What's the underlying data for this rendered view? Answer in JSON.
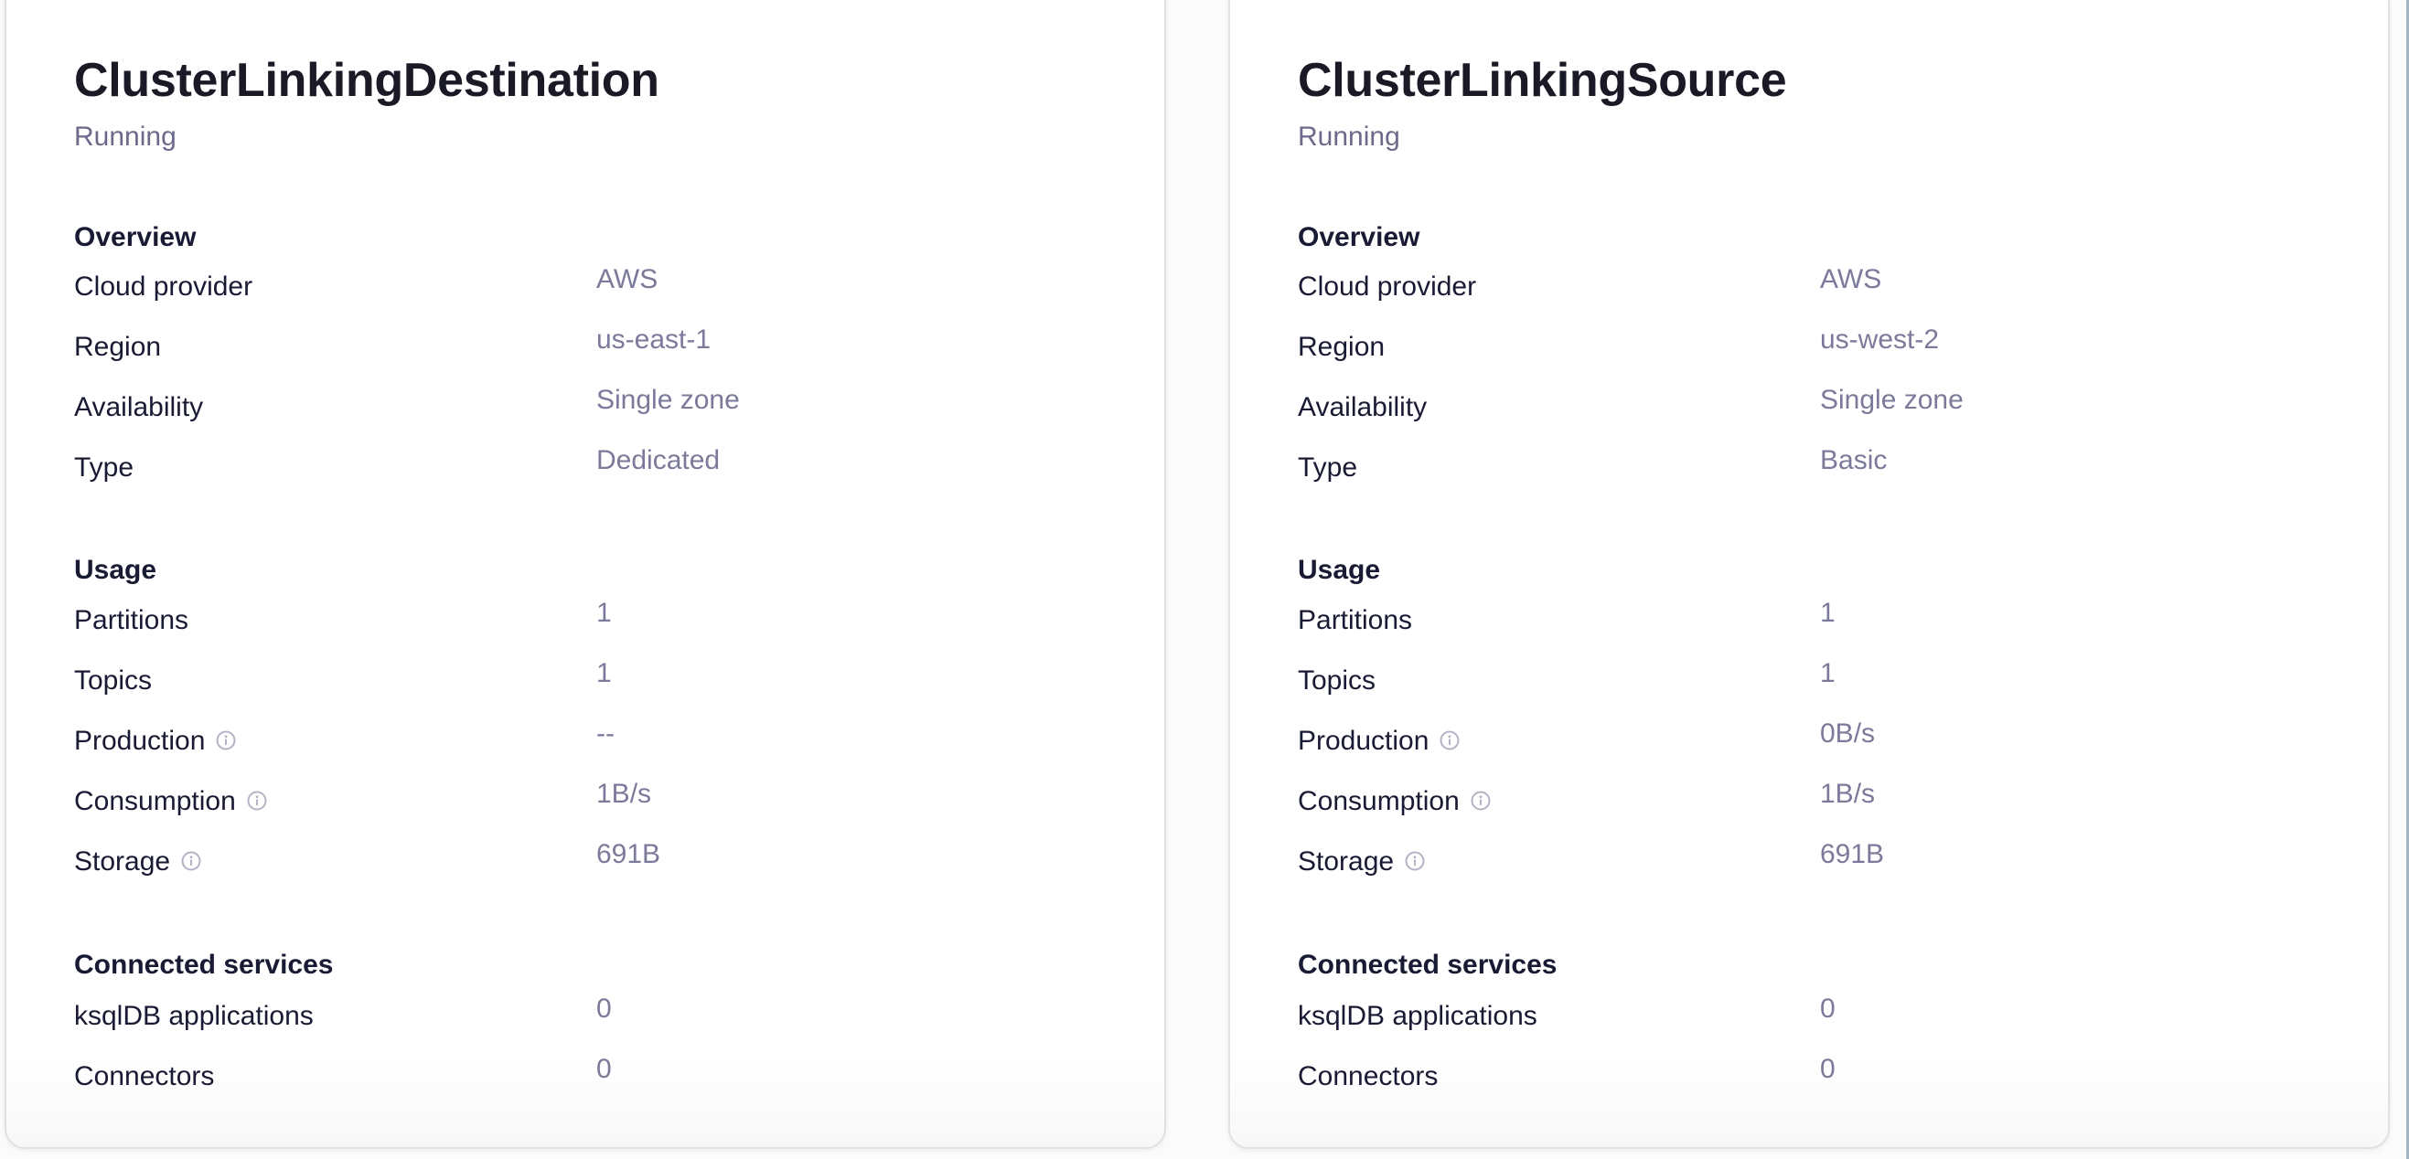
{
  "clusters": [
    {
      "name": "ClusterLinkingDestination",
      "status": "Running",
      "overview": {
        "heading": "Overview",
        "rows": [
          {
            "label": "Cloud provider",
            "value": "AWS"
          },
          {
            "label": "Region",
            "value": "us-east-1"
          },
          {
            "label": "Availability",
            "value": "Single zone"
          },
          {
            "label": "Type",
            "value": "Dedicated"
          }
        ]
      },
      "usage": {
        "heading": "Usage",
        "rows": [
          {
            "label": "Partitions",
            "value": "1",
            "info": false
          },
          {
            "label": "Topics",
            "value": "1",
            "info": false
          },
          {
            "label": "Production",
            "value": "--",
            "info": true
          },
          {
            "label": "Consumption",
            "value": "1B/s",
            "info": true
          },
          {
            "label": "Storage",
            "value": "691B",
            "info": true
          }
        ]
      },
      "connected_services": {
        "heading": "Connected services",
        "rows": [
          {
            "label": "ksqlDB applications",
            "value": "0"
          },
          {
            "label": "Connectors",
            "value": "0"
          }
        ]
      }
    },
    {
      "name": "ClusterLinkingSource",
      "status": "Running",
      "overview": {
        "heading": "Overview",
        "rows": [
          {
            "label": "Cloud provider",
            "value": "AWS"
          },
          {
            "label": "Region",
            "value": "us-west-2"
          },
          {
            "label": "Availability",
            "value": "Single zone"
          },
          {
            "label": "Type",
            "value": "Basic"
          }
        ]
      },
      "usage": {
        "heading": "Usage",
        "rows": [
          {
            "label": "Partitions",
            "value": "1",
            "info": false
          },
          {
            "label": "Topics",
            "value": "1",
            "info": false
          },
          {
            "label": "Production",
            "value": "0B/s",
            "info": true
          },
          {
            "label": "Consumption",
            "value": "1B/s",
            "info": true
          },
          {
            "label": "Storage",
            "value": "691B",
            "info": true
          }
        ]
      },
      "connected_services": {
        "heading": "Connected services",
        "rows": [
          {
            "label": "ksqlDB applications",
            "value": "0"
          },
          {
            "label": "Connectors",
            "value": "0"
          }
        ]
      }
    }
  ],
  "icons": {
    "info": "info-circle-icon"
  },
  "colors": {
    "title": "#191a26",
    "label": "#191a33",
    "value": "#7b7a9a",
    "status": "#6b6a8a",
    "info_icon": "#b4b3c6",
    "card_border": "#e1e1e4"
  }
}
